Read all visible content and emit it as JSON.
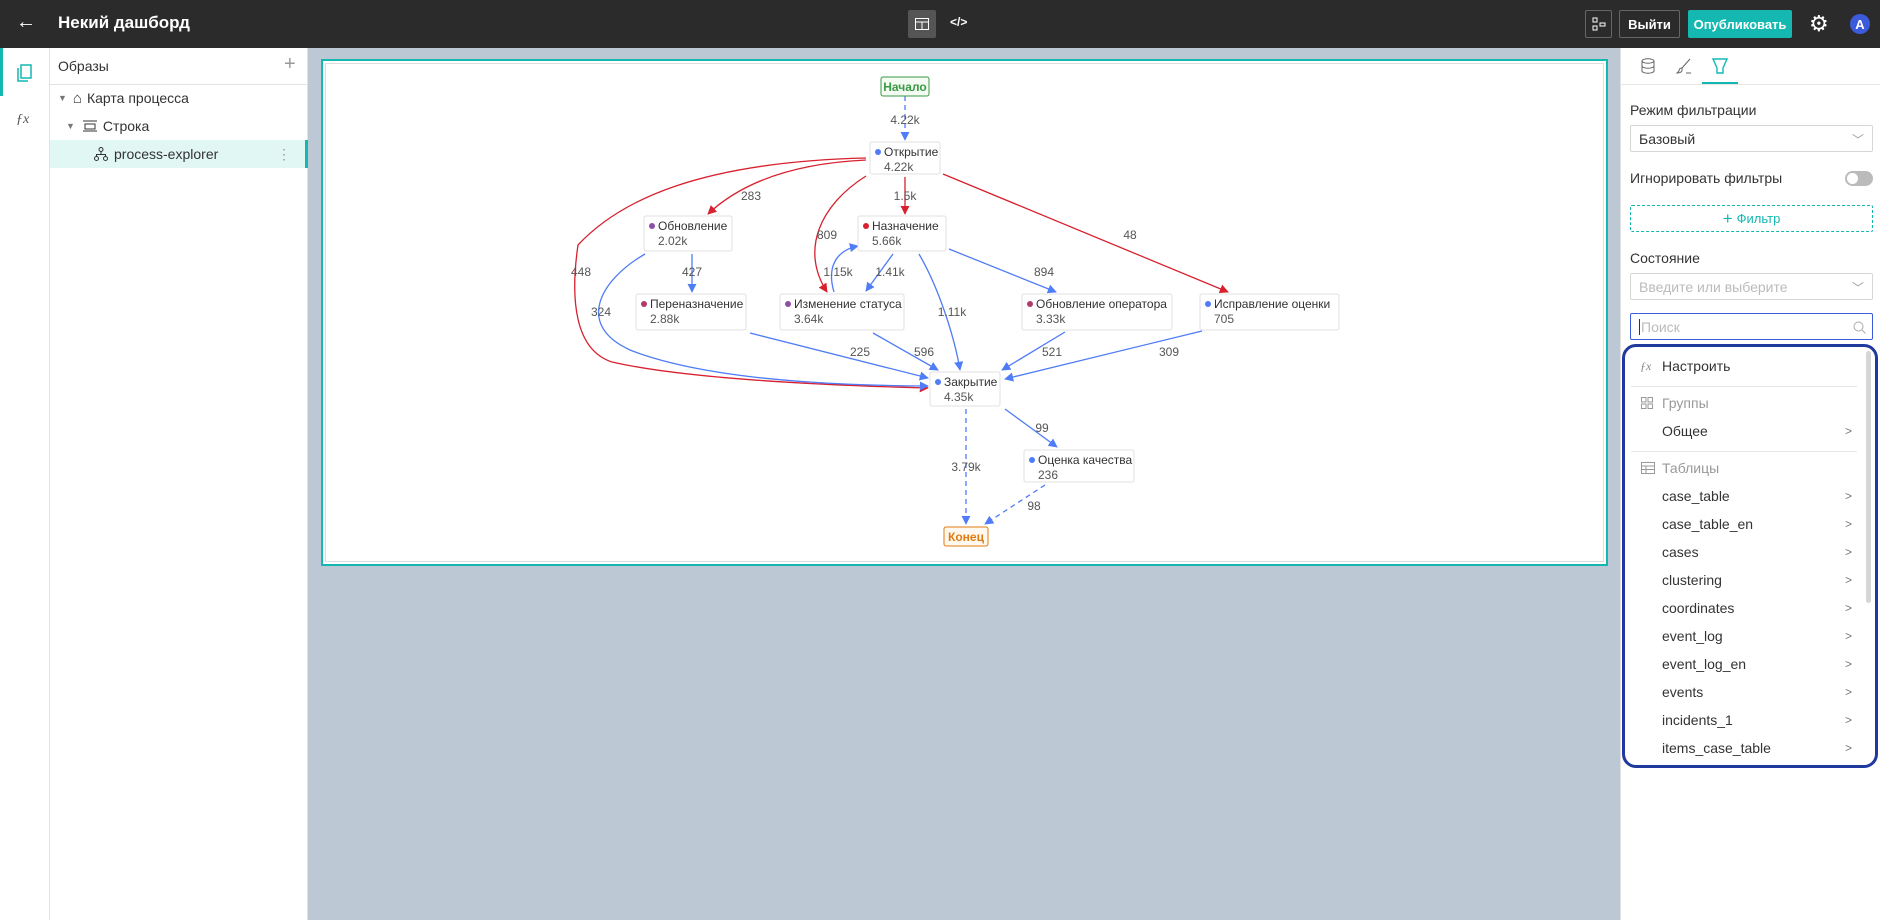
{
  "header": {
    "title": "Некий дашборд",
    "logout_label": "Выйти",
    "publish_label": "Опубликовать",
    "avatar_letter": "A",
    "accent": "#14b8b0"
  },
  "tree": {
    "title": "Образы",
    "items": [
      {
        "label": "Карта процесса",
        "icon": "home-icon"
      },
      {
        "label": "Строка",
        "icon": "row-icon"
      },
      {
        "label": "process-explorer",
        "icon": "process-icon",
        "selected": true
      }
    ]
  },
  "graph": {
    "start": "Начало",
    "end": "Конец",
    "nodes": [
      {
        "id": "open",
        "name": "Открытие",
        "count": "4.22k",
        "color": "#4f7cf7"
      },
      {
        "id": "upd",
        "name": "Обновление",
        "count": "2.02k",
        "color": "#8e4fa6"
      },
      {
        "id": "assign",
        "name": "Назначение",
        "count": "5.66k",
        "color": "#d8202e"
      },
      {
        "id": "reassign",
        "name": "Переназначение",
        "count": "2.88k",
        "color": "#b03a6a"
      },
      {
        "id": "status",
        "name": "Изменение статуса",
        "count": "3.64k",
        "color": "#8e4fa6"
      },
      {
        "id": "opupd",
        "name": "Обновление оператора",
        "count": "3.33k",
        "color": "#b03a6a"
      },
      {
        "id": "fix",
        "name": "Исправление оценки",
        "count": "705",
        "color": "#4f7cf7"
      },
      {
        "id": "close",
        "name": "Закрытие",
        "count": "4.35k",
        "color": "#4f7cf7"
      },
      {
        "id": "qa",
        "name": "Оценка качества",
        "count": "236",
        "color": "#4f7cf7"
      }
    ],
    "edges": [
      {
        "from": "start",
        "to": "open",
        "label": "4.22k",
        "color": "#4f7cf7",
        "dashed": true
      },
      {
        "from": "open",
        "to": "upd",
        "label": "283",
        "color": "#d8202e"
      },
      {
        "from": "open",
        "to": "assign",
        "label": "1.5k",
        "color": "#d8202e"
      },
      {
        "from": "open",
        "to": "fix",
        "label": "48",
        "color": "#d8202e"
      },
      {
        "from": "open",
        "to": "status",
        "label": "809",
        "color": "#d8202e"
      },
      {
        "from": "open",
        "to": "close",
        "label": "448",
        "color": "#d8202e"
      },
      {
        "from": "upd",
        "to": "reassign",
        "label": "427",
        "color": "#4f7cf7"
      },
      {
        "from": "status",
        "to": "assign",
        "label": "1.15k",
        "color": "#4f7cf7"
      },
      {
        "from": "assign",
        "to": "status",
        "label": "1.41k",
        "color": "#4f7cf7"
      },
      {
        "from": "assign",
        "to": "opupd",
        "label": "894",
        "color": "#4f7cf7"
      },
      {
        "from": "upd",
        "to": "close",
        "label": "324",
        "color": "#4f7cf7"
      },
      {
        "from": "assign",
        "to": "close",
        "label": "1.11k",
        "color": "#4f7cf7"
      },
      {
        "from": "reassign",
        "to": "close",
        "label": "225",
        "color": "#4f7cf7"
      },
      {
        "from": "status",
        "to": "close",
        "label": "596",
        "color": "#4f7cf7"
      },
      {
        "from": "opupd",
        "to": "close",
        "label": "521",
        "color": "#4f7cf7"
      },
      {
        "from": "fix",
        "to": "close",
        "label": "309",
        "color": "#4f7cf7"
      },
      {
        "from": "close",
        "to": "qa",
        "label": "99",
        "color": "#4f7cf7"
      },
      {
        "from": "close",
        "to": "end",
        "label": "3.79k",
        "color": "#4f7cf7",
        "dashed": true
      },
      {
        "from": "qa",
        "to": "end",
        "label": "98",
        "color": "#4f7cf7",
        "dashed": true
      }
    ]
  },
  "panel": {
    "tabs": [
      {
        "icon": "database-icon"
      },
      {
        "icon": "brush-icon"
      },
      {
        "icon": "filter-icon",
        "active": true
      }
    ],
    "filter_mode_label": "Режим фильтрации",
    "filter_mode_value": "Базовый",
    "ignore_filters_label": "Игнорировать фильтры",
    "ignore_filters_on": false,
    "add_filter_label": "Фильтр",
    "state_label": "Состояние",
    "state_placeholder": "Введите или выберите",
    "search_placeholder": "Поиск"
  },
  "dropdown": {
    "customize": "Настроить",
    "groups_header": "Группы",
    "groups": [
      "Общее"
    ],
    "tables_header": "Таблицы",
    "tables": [
      "case_table",
      "case_table_en",
      "cases",
      "clustering",
      "coordinates",
      "event_log",
      "event_log_en",
      "events",
      "incidents_1",
      "items_case_table"
    ]
  }
}
